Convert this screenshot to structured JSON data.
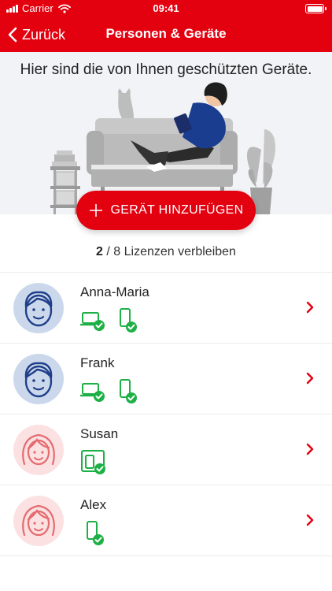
{
  "status_bar": {
    "carrier": "Carrier",
    "time": "09:41"
  },
  "navbar": {
    "back_label": "Zurück",
    "title": "Personen & Geräte"
  },
  "hero": {
    "text": "Hier sind die von Ihnen geschützten Geräte."
  },
  "add_button": {
    "label": "GERÄT HINZUFÜGEN"
  },
  "licenses": {
    "remaining": "2",
    "rest": " / 8 Lizenzen verbleiben"
  },
  "colors": {
    "brand_red": "#e3000f",
    "check_green": "#1db045",
    "male_avatar_bg": "#cbd8ec",
    "female_avatar_bg": "#fbe1e2"
  },
  "people": [
    {
      "name": "Anna-Maria",
      "avatar": "male-avatar-icon",
      "devices": [
        "laptop-check-icon",
        "phone-check-icon"
      ]
    },
    {
      "name": "Frank",
      "avatar": "male-avatar-icon",
      "devices": [
        "laptop-check-icon",
        "phone-check-icon"
      ]
    },
    {
      "name": "Susan",
      "avatar": "female-avatar-icon",
      "devices": [
        "multi-device-check-icon"
      ]
    },
    {
      "name": "Alex",
      "avatar": "female-avatar-icon",
      "devices": [
        "phone-check-icon"
      ]
    }
  ]
}
